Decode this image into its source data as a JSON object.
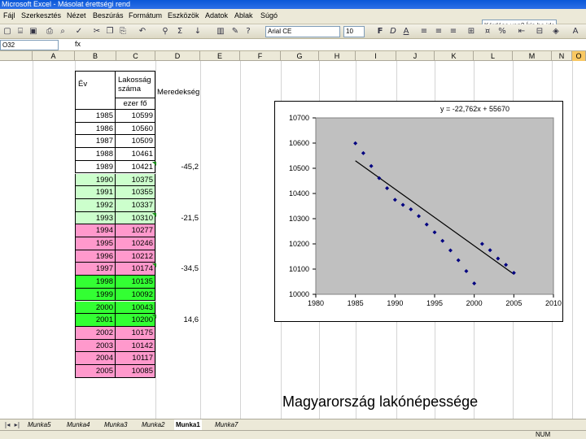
{
  "window": {
    "title": "Microsoft Excel - Másolat érettségi rend"
  },
  "menu": [
    "Fájl",
    "Szerkesztés",
    "Nézet",
    "Beszúrás",
    "Formátum",
    "Eszközök",
    "Adatok",
    "Ablak",
    "Súgó"
  ],
  "help_search": {
    "value": "Kérdése van? Írja be ide"
  },
  "toolbar": {
    "font_name": "Arial CE",
    "font_size": "10",
    "bold": "F",
    "italic": "D",
    "underline": "A",
    "percent": "%"
  },
  "formula_bar": {
    "name_box": "O32",
    "fx": "fx"
  },
  "columns": [
    "A",
    "B",
    "C",
    "D",
    "E",
    "F",
    "G",
    "H",
    "I",
    "J",
    "K",
    "L",
    "M",
    "N",
    "O"
  ],
  "table": {
    "header_year": "Év",
    "header_pop_line1": "Lakosság",
    "header_pop_line2": "száma",
    "header_pop_unit": "ezer fő",
    "header_change": "Meredekség",
    "rows": [
      {
        "year": "1985",
        "value": "10599",
        "tone": "white"
      },
      {
        "year": "1986",
        "value": "10560",
        "tone": "white"
      },
      {
        "year": "1987",
        "value": "10509",
        "tone": "white"
      },
      {
        "year": "1988",
        "value": "10461",
        "tone": "white"
      },
      {
        "year": "1989",
        "value": "10421",
        "tone": "white"
      },
      {
        "year": "1990",
        "value": "10375",
        "tone": "lightgreen"
      },
      {
        "year": "1991",
        "value": "10355",
        "tone": "lightgreen"
      },
      {
        "year": "1992",
        "value": "10337",
        "tone": "lightgreen"
      },
      {
        "year": "1993",
        "value": "10310",
        "tone": "lightgreen"
      },
      {
        "year": "1994",
        "value": "10277",
        "tone": "pink"
      },
      {
        "year": "1995",
        "value": "10246",
        "tone": "pink"
      },
      {
        "year": "1996",
        "value": "10212",
        "tone": "pink"
      },
      {
        "year": "1997",
        "value": "10174",
        "tone": "pink"
      },
      {
        "year": "1998",
        "value": "10135",
        "tone": "green"
      },
      {
        "year": "1999",
        "value": "10092",
        "tone": "green"
      },
      {
        "year": "2000",
        "value": "10043",
        "tone": "green"
      },
      {
        "year": "2001",
        "value": "10200",
        "tone": "green"
      },
      {
        "year": "2002",
        "value": "10175",
        "tone": "pink"
      },
      {
        "year": "2003",
        "value": "10142",
        "tone": "pink"
      },
      {
        "year": "2004",
        "value": "10117",
        "tone": "pink"
      },
      {
        "year": "2005",
        "value": "10085",
        "tone": "pink"
      }
    ],
    "changes": [
      {
        "row": 4,
        "value": "-45,2"
      },
      {
        "row": 8,
        "value": "-21,5"
      },
      {
        "row": 12,
        "value": "-34,5"
      },
      {
        "row": 16,
        "value": "14,6"
      }
    ]
  },
  "colors": {
    "lightgreen": "#ccffcc",
    "pink": "#ff99cc",
    "green": "#33ff33",
    "white": "#ffffff",
    "plot_bg": "#c0c0c0",
    "marker": "#000080"
  },
  "chart_data": {
    "type": "scatter",
    "trendline_label": "y = -22,762x + 55670",
    "x": [
      1985,
      1986,
      1987,
      1988,
      1989,
      1990,
      1991,
      1992,
      1993,
      1994,
      1995,
      1996,
      1997,
      1998,
      1999,
      2000,
      2001,
      2002,
      2003,
      2004,
      2005
    ],
    "y": [
      10599,
      10560,
      10509,
      10461,
      10421,
      10375,
      10355,
      10337,
      10310,
      10277,
      10246,
      10212,
      10174,
      10135,
      10092,
      10043,
      10200,
      10175,
      10142,
      10117,
      10085
    ],
    "xlim": [
      1980,
      2010
    ],
    "ylim": [
      10000,
      10700
    ],
    "x_ticks": [
      "1980",
      "1985",
      "1990",
      "1995",
      "2000",
      "2005",
      "2010"
    ],
    "y_ticks": [
      "10000",
      "10100",
      "10200",
      "10300",
      "10400",
      "10500",
      "10600",
      "10700"
    ],
    "trendline": [
      [
        1985,
        10530
      ],
      [
        2005,
        10080
      ]
    ]
  },
  "caption": "Magyarország lakónépessége",
  "sheet_tabs": [
    "Munka5",
    "Munka4",
    "Munka3",
    "Munka2",
    "Munka1",
    "Munka7"
  ],
  "active_tab": "Munka1",
  "status": {
    "num": "NUM"
  }
}
